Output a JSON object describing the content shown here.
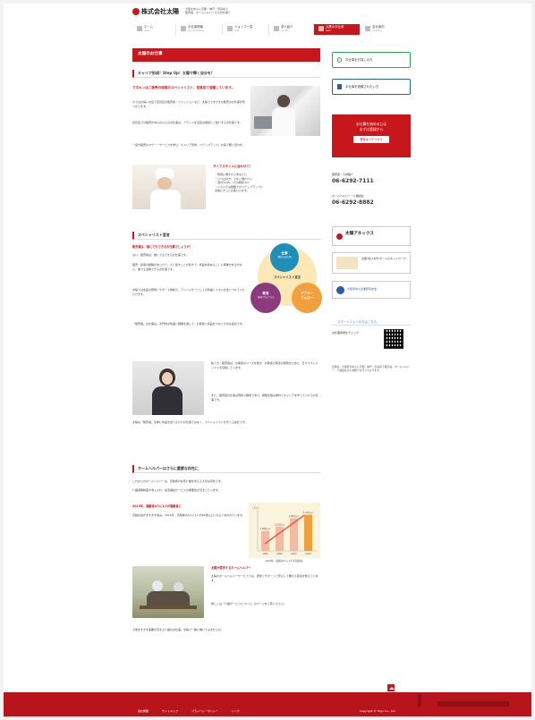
{
  "header": {
    "logo_text": "株式会社太陽",
    "tagline_1": "大阪を中心に京都・神戸・奈良県で",
    "tagline_2": "販売員、ホームヘルパーの人材を紹介"
  },
  "gnav": [
    {
      "label": "ホーム",
      "sub": "home"
    },
    {
      "label": "お仕事情報",
      "sub": "job information"
    },
    {
      "label": "ショップ一覧",
      "sub": "shop"
    },
    {
      "label": "求人紹介",
      "sub": "recruit"
    },
    {
      "label": "太陽のお仕事",
      "sub": "work"
    },
    {
      "label": "会社案内",
      "sub": "company"
    }
  ],
  "main": {
    "page_title": "太陽のお仕事",
    "section1": {
      "heading": "キャリア形成！Step Up！太陽で輝く自分を!",
      "lead": "マネキンはこ販売の接客のスペシャリスト、百貨店で活躍しています。",
      "body_1": "今ではお得いお店で百貨店の販売員・ファッションなど、太陽でさまざまな販売のお仕事が見つかります。",
      "body_2": "百貨店での販売が中心のひらのお仕事は、ブランドを直接お客様にご紹介するお仕事です。",
      "body_3": "一度き販売のマナー・サービスを学び、キャリア形成、ステップアップ。お得で輝く自分を。",
      "lifestyle_title": "ライフスタイルに合わせて！",
      "lifestyle_list": [
        "・隙間に働きたいあなたに",
        "・いつも好き！少なく働きたい",
        "・週2日以内、1日4時間 etc.",
        "・いろいろな経験でのステップアップに"
      ],
      "lifestyle_note": "太陽にきっとお使いいます。"
    },
    "section2": {
      "heading": "スペシャリスト宣言",
      "lead": "販売員は、誰にでもできるお仕事でしょうか？",
      "body_1": "はい、販売員は、誰にでもできるお仕事です。",
      "body_2": "販売・接客の経験があったり、人と話すことが好きで、商品を勧めることに興味がある方なら、誰でも活躍できるお仕事です。",
      "body_3": "太陽では充実の研修とサポート体制で、アドバイザーとしての知識とスキルを身につけていただけます。",
      "body_4": "「販売員」の仕事は、専門的な知識と経験を通して、お客様と商品をつなぐ大切な役割です。",
      "body_5": "私たち・販売員は、お客様のニーズを聞き、お客様の満足の笑顔のために、日々スペシャリストを目指しています。",
      "body_6": "また、販売員の仕事は現場で職場で学び、経験を積み重ねてキャリアを作っていけるお仕事です。",
      "body_7": "太陽は「販売員」を単に商品を並べるだけの仕事ではなく、スペシャリストを育てる会社です。"
    },
    "venn": {
      "center": "スペシャリスト宣言",
      "c1": "仕事",
      "c1_sub": "(販売のお仕事)",
      "c2": "教育",
      "c2_sub": "(研修プログラム)",
      "c3": "アフター",
      "c3_sub": "フォロー"
    },
    "section3": {
      "heading": "ホームヘルパーはさらに重要な存在に",
      "body_1": "これからのホームヘルパーは、高齢者の在宅介護を支える大切な存在です。",
      "body_2": "介護保険制度が導入され、在宅福祉サービスの重要性が高まっています。",
      "sub_lead": "2015年、高齢者4人に1人が高齢者に",
      "sub_body": "高齢社会がますます進み、2015年、高齢者の4人に1人が65歳以上になると言われています。",
      "lead_2": "太陽が提供するホームヘルパー",
      "body_3": "太陽のホームヘルパーサービスでは、研修とサポートで安心して働ける環境を整えています。",
      "body_4": "詳しくは「介護サービスについて」のページをご覧ください。",
      "body_5": "今後ますます需要が高まる介護のお仕事。太陽で一緒に働いてみませんか。",
      "chart_caption": "2015年、高齢者4人に1人が高齢者に"
    }
  },
  "chart_data": {
    "type": "bar",
    "categories": [
      "1995",
      "2000",
      "2015",
      "2020"
    ],
    "values": [
      1828,
      2220,
      3000,
      3313
    ],
    "value_labels": [
      "1,828万人",
      "2,220万人",
      "3,000万人",
      "3,313万人"
    ],
    "ylabel": "(万人)"
  },
  "sidebar": {
    "search_label": "お仕事をお探しの方",
    "register_label": "お仕事を依頼されたい方",
    "recruit_text_1": "お仕事を始めるには",
    "recruit_text_2": "まずは登録から",
    "recruit_button": "登録はコチラから",
    "contact_1_label": "販売員・人材紹介",
    "contact_1_phone": "06-6292-7111",
    "contact_2_label": "ホームヘルパー・介護会社",
    "contact_2_phone": "06-6292-8882",
    "annex": "太陽アネックス",
    "banner_2": "全国7社人材サポートのネットワーク",
    "banner_3": "大阪府中小企業家同友会",
    "smartphone_title": "スマートフォンの方はこちら",
    "smartphone_text": "お仕事情報をチェック",
    "note": "太陽は、大阪府を中心に京都・神戸・奈良県で販売員、ホームヘルパー、介護会社の人材紹介を行っております。"
  },
  "footer": {
    "links": [
      "会社概要",
      "サイトマップ",
      "プライバシーポリシー",
      "リンク"
    ],
    "copyright": "Copyright © Taiyo Co., Ltd"
  },
  "colors": {
    "accent": "#c8161d",
    "green": "#2fa84f",
    "blue": "#2a5ea8",
    "teal": "#2a8fa7",
    "purple": "#8a3a7d",
    "orange": "#f0a03c"
  }
}
